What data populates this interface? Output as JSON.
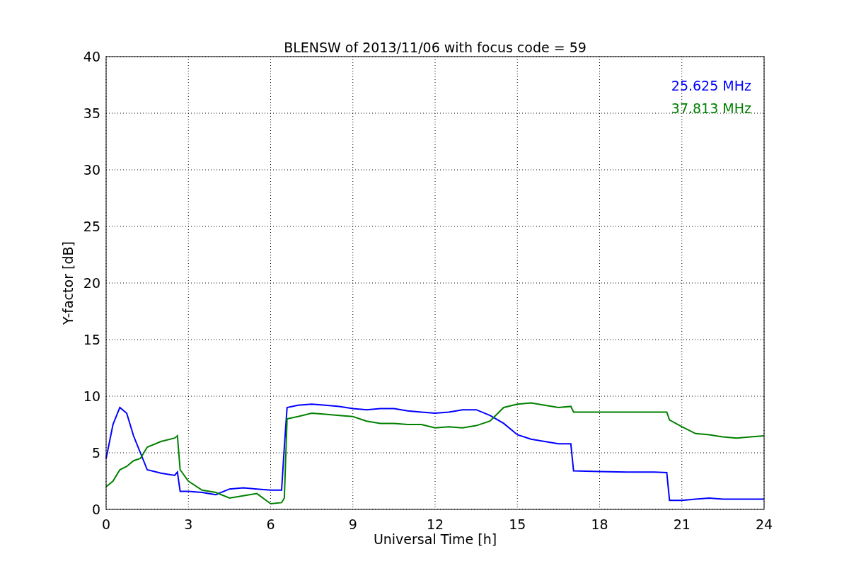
{
  "chart_data": {
    "type": "line",
    "title": "BLENSW of 2013/11/06 with focus code = 59",
    "xlabel": "Universal Time [h]",
    "ylabel": "Y-factor [dB]",
    "x": [
      0,
      0.25,
      0.5,
      0.75,
      1,
      1.25,
      1.5,
      2,
      2.5,
      2.6,
      2.7,
      3,
      3.5,
      4,
      4.5,
      5,
      5.5,
      6,
      6.4,
      6.5,
      6.6,
      7,
      7.5,
      8,
      8.5,
      9,
      9.5,
      10,
      10.5,
      11,
      11.5,
      12,
      12.5,
      13,
      13.5,
      14,
      14.5,
      15,
      15.5,
      16,
      16.5,
      16.95,
      17.05,
      18,
      19,
      20,
      20.45,
      20.55,
      21,
      21.5,
      22,
      22.5,
      23,
      23.5,
      24
    ],
    "series": [
      {
        "name": "25.625 MHz",
        "color": "#0000ff",
        "values": [
          4.5,
          7.5,
          9,
          8.5,
          6.5,
          5,
          3.5,
          3.2,
          3,
          3.3,
          1.6,
          1.6,
          1.5,
          1.3,
          1.8,
          1.9,
          1.8,
          1.7,
          1.7,
          5.5,
          9,
          9.2,
          9.3,
          9.2,
          9.1,
          8.9,
          8.8,
          8.9,
          8.9,
          8.7,
          8.6,
          8.5,
          8.6,
          8.8,
          8.8,
          8.3,
          7.6,
          6.6,
          6.2,
          6,
          5.8,
          5.8,
          3.4,
          3.35,
          3.3,
          3.3,
          3.25,
          0.8,
          0.8,
          0.9,
          1,
          0.9,
          0.9,
          0.9,
          0.9
        ]
      },
      {
        "name": "37.813 MHz",
        "color": "#008000",
        "values": [
          2,
          2.5,
          3.5,
          3.8,
          4.3,
          4.5,
          5.5,
          6,
          6.3,
          6.5,
          3.5,
          2.5,
          1.7,
          1.5,
          1,
          1.2,
          1.4,
          0.5,
          0.6,
          1,
          8,
          8.2,
          8.5,
          8.4,
          8.3,
          8.2,
          7.8,
          7.6,
          7.6,
          7.5,
          7.5,
          7.2,
          7.3,
          7.2,
          7.4,
          7.8,
          9,
          9.3,
          9.4,
          9.2,
          9,
          9.1,
          8.6,
          8.6,
          8.6,
          8.6,
          8.6,
          7.9,
          7.3,
          6.7,
          6.6,
          6.4,
          6.3,
          6.4,
          6.5
        ]
      }
    ],
    "grid": true,
    "xlim": [
      0,
      24
    ],
    "ylim": [
      0,
      40
    ],
    "xticks": [
      0,
      3,
      6,
      9,
      12,
      15,
      18,
      21,
      24
    ],
    "yticks": [
      0,
      5,
      10,
      15,
      20,
      25,
      30,
      35,
      40
    ]
  }
}
